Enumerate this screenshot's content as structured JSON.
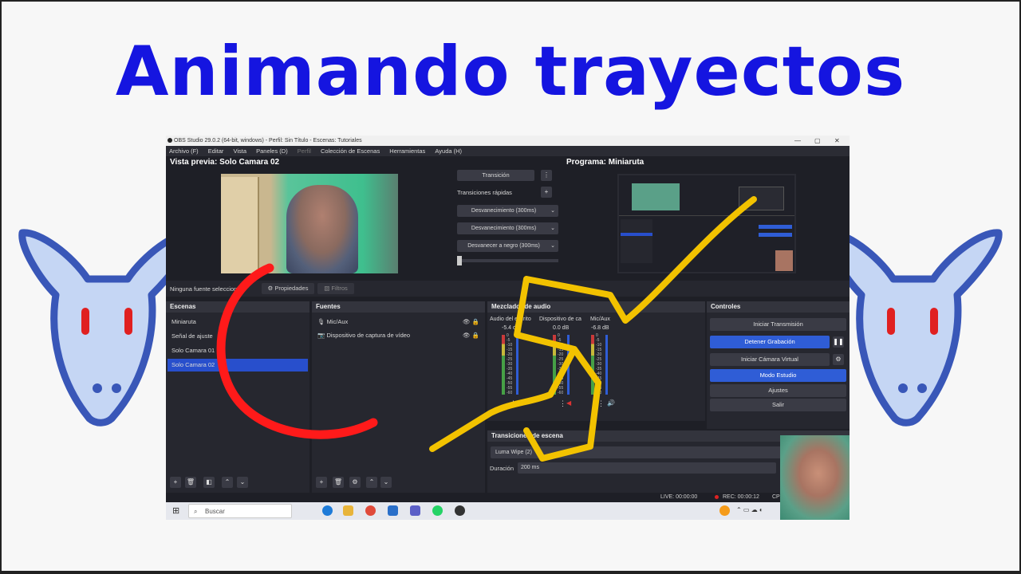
{
  "headline": "Animando trayectos",
  "window": {
    "title": "OBS Studio 29.0.2 (64-bit, windows) - Perfil: Sin Título - Escenas: Tutoriales",
    "minimize": "—",
    "maximize": "▢",
    "close": "✕"
  },
  "menu": [
    "Archivo (F)",
    "Editar",
    "Vista",
    "Paneles (D)",
    "Perfil",
    "Colección de Escenas",
    "Herramientas",
    "Ayuda (H)"
  ],
  "preview": {
    "title": "Vista previa: Solo Camara 02"
  },
  "program": {
    "title": "Programa: Miniaruta"
  },
  "transitions": {
    "button": "Transición",
    "quick_label": "Transiciones rápidas",
    "items": [
      "Desvanecimiento (300ms)",
      "Desvanecimiento (300ms)",
      "Desvanecer a negro (300ms)"
    ]
  },
  "source_bar": {
    "label": "Ninguna fuente seleccion",
    "properties": "Propiedades",
    "filters": "Filtros"
  },
  "scenes": {
    "title": "Escenas",
    "items": [
      "Miniaruta",
      "Señal de ajuste",
      "Solo Camara 01",
      "Solo Camara 02"
    ],
    "selected_index": 3
  },
  "sources": {
    "title": "Fuentes",
    "items": [
      "Mic/Aux",
      "Dispositivo de captura de vídeo"
    ]
  },
  "mixer": {
    "title": "Mezclador de audio",
    "channels": [
      {
        "name": "Audio del escrito",
        "db": "-5.4 dB"
      },
      {
        "name": "Dispositivo de ca",
        "db": "0.0 dB"
      },
      {
        "name": "Mic/Aux",
        "db": "-6.8 dB"
      }
    ],
    "scale": [
      "0",
      "-5",
      "-10",
      "-15",
      "-20",
      "-25",
      "-30",
      "-35",
      "-40",
      "-45",
      "-50",
      "-55",
      "-60"
    ]
  },
  "scene_transitions": {
    "title": "Transiciones de escena",
    "selected": "Luma Wipe (2)",
    "duration_label": "Duración",
    "duration_value": "200 ms"
  },
  "controls": {
    "title": "Controles",
    "start_stream": "Iniciar Transmisión",
    "stop_record": "Detener Grabación",
    "virtual_cam": "Iniciar Cámara Virtual",
    "studio_mode": "Modo Estudio",
    "settings": "Ajustes",
    "exit": "Salir"
  },
  "status": {
    "live": "LIVE: 00:00:00",
    "rec": "REC: 00:00:12",
    "cpu": "CPU"
  },
  "taskbar": {
    "search_placeholder": "Buscar"
  },
  "colors": {
    "headline": "#1515e0",
    "obs_bg": "#1e1f26",
    "accent_blue": "#2f5dd6",
    "path_yellow": "#f2c200",
    "arc_red": "#ff1a1a"
  }
}
